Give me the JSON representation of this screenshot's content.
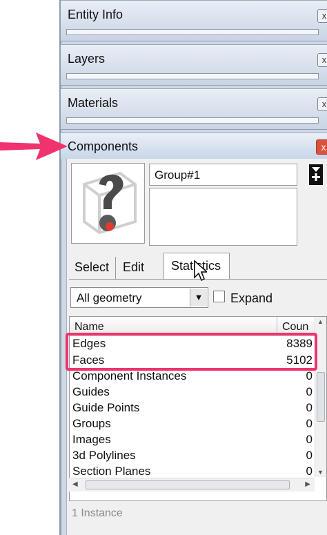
{
  "panels": {
    "entity_info": {
      "title": "Entity Info"
    },
    "layers": {
      "title": "Layers"
    },
    "materials": {
      "title": "Materials"
    }
  },
  "components": {
    "title": "Components",
    "name_value": "Group#1",
    "description_value": "",
    "tabs": [
      {
        "label": "Select",
        "active": false
      },
      {
        "label": "Edit",
        "active": false
      },
      {
        "label": "Statistics",
        "active": true
      }
    ],
    "filter": {
      "selected": "All geometry"
    },
    "expand": {
      "label": "Expand",
      "checked": false
    },
    "list": {
      "headers": {
        "name": "Name",
        "count": "Coun"
      },
      "rows": [
        {
          "name": "Edges",
          "count": "8389"
        },
        {
          "name": "Faces",
          "count": "5102"
        },
        {
          "name": "Component Instances",
          "count": "0"
        },
        {
          "name": "Guides",
          "count": "0"
        },
        {
          "name": "Guide Points",
          "count": "0"
        },
        {
          "name": "Groups",
          "count": "0"
        },
        {
          "name": "Images",
          "count": "0"
        },
        {
          "name": "3d Polylines",
          "count": "0"
        },
        {
          "name": "Section Planes",
          "count": "0"
        }
      ]
    },
    "footer": "1 Instance",
    "close_glyph": "x"
  },
  "icons": {
    "close": "close-icon",
    "details": "details-arrow-icon",
    "dropdown": "chevron-down-icon",
    "thumbnail": "question-mark-component-icon",
    "cursor": "mouse-pointer-icon",
    "annotation_arrow": "pink-arrow-icon"
  },
  "colors": {
    "highlight": "#f0336e",
    "close_active": "#d9533a",
    "panel_bar": "#c9d4e3"
  }
}
